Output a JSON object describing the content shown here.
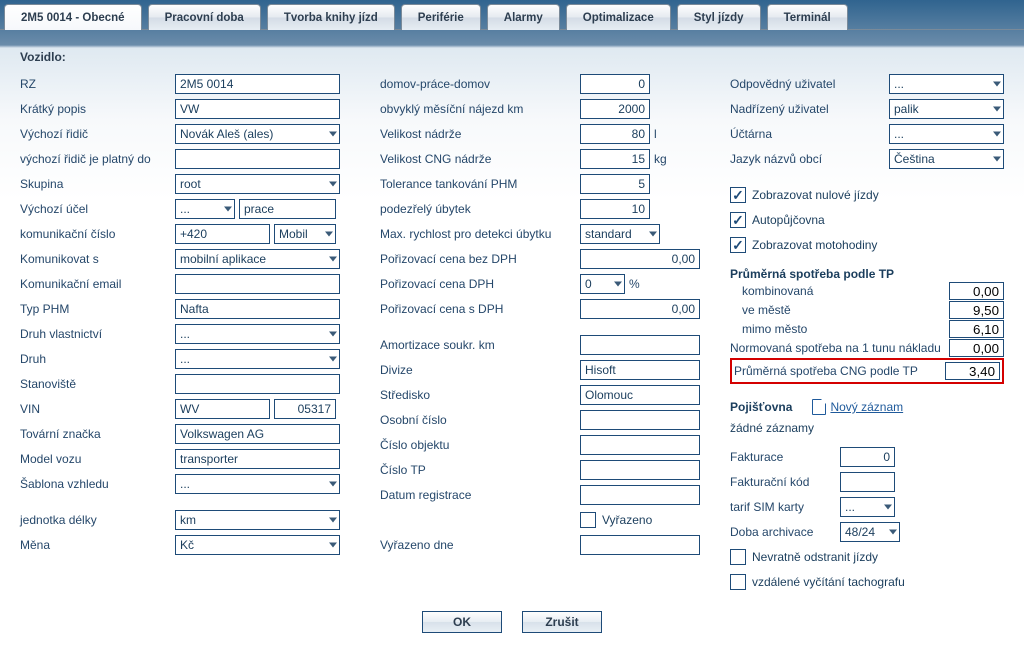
{
  "tabs": {
    "active": "2M5 0014 - Obecné",
    "items": [
      "Pracovní doba",
      "Tvorba knihy jízd",
      "Periférie",
      "Alarmy",
      "Optimalizace",
      "Styl jízdy",
      "Terminál"
    ]
  },
  "section_vehicle": "Vozidlo:",
  "col1": {
    "rz": {
      "label": "RZ",
      "value": "2M5 0014"
    },
    "kratky": {
      "label": "Krátký popis",
      "value": "VW"
    },
    "vychozi_ridic": {
      "label": "Výchozí řidič",
      "value": "Novák Aleš (ales)"
    },
    "platny_do": {
      "label": "výchozí řidič je platný do",
      "value": ""
    },
    "skupina": {
      "label": "Skupina",
      "value": "root"
    },
    "vychozi_ucel": {
      "label": "Výchozí účel",
      "sel": "...",
      "txt": "prace"
    },
    "kom_cislo": {
      "label": "komunikační číslo",
      "value": "+420",
      "badge": "Mobil"
    },
    "komunikovat_s": {
      "label": "Komunikovat s",
      "value": "mobilní aplikace"
    },
    "kom_email": {
      "label": "Komunikační email",
      "value": ""
    },
    "typ_phm": {
      "label": "Typ PHM",
      "value": "Nafta"
    },
    "druh_vlast": {
      "label": "Druh vlastnictví",
      "value": "..."
    },
    "druh": {
      "label": "Druh",
      "value": "..."
    },
    "stanoviste": {
      "label": "Stanoviště",
      "value": ""
    },
    "vin": {
      "label": "VIN",
      "left": "WV",
      "right": "05317"
    },
    "znacka": {
      "label": "Tovární značka",
      "value": "Volkswagen AG"
    },
    "model": {
      "label": "Model vozu",
      "value": "transporter"
    },
    "sablona": {
      "label": "Šablona vzhledu",
      "value": "..."
    },
    "jednotka": {
      "label": "jednotka délky",
      "value": "km"
    },
    "mena": {
      "label": "Měna",
      "value": "Kč"
    }
  },
  "col2": {
    "domov": {
      "label": "domov-práce-domov",
      "value": "0"
    },
    "najezd": {
      "label": "obvyklý měsíční nájezd km",
      "value": "2000"
    },
    "nadrz": {
      "label": "Velikost nádrže",
      "value": "80",
      "unit": "l"
    },
    "cng": {
      "label": "Velikost CNG nádrže",
      "value": "15",
      "unit": "kg"
    },
    "tolerance": {
      "label": "Tolerance tankování PHM",
      "value": "5"
    },
    "ubytek": {
      "label": "podezřelý úbytek",
      "value": "10"
    },
    "maxrychlost": {
      "label": "Max. rychlost pro detekci úbytku",
      "value": "standard"
    },
    "cenabez": {
      "label": "Pořizovací cena bez DPH",
      "value": "0,00"
    },
    "cenadph": {
      "label": "Pořizovací cena DPH",
      "sel": "0",
      "unit": "%"
    },
    "cenas": {
      "label": "Pořizovací cena s DPH",
      "value": "0,00"
    },
    "amortizace": {
      "label": "Amortizace soukr. km",
      "value": ""
    },
    "divize": {
      "label": "Divize",
      "value": "Hisoft"
    },
    "stredisko": {
      "label": "Středisko",
      "value": "Olomouc"
    },
    "oscislo": {
      "label": "Osobní číslo",
      "value": ""
    },
    "cisloobj": {
      "label": "Číslo objektu",
      "value": ""
    },
    "cislotp": {
      "label": "Číslo TP",
      "value": ""
    },
    "datum": {
      "label": "Datum registrace",
      "value": ""
    },
    "vyrazeno_chk": {
      "label": "Vyřazeno",
      "checked": false
    },
    "vyrazeno_dne": {
      "label": "Vyřazeno dne",
      "value": ""
    }
  },
  "col3": {
    "odpovedny": {
      "label": "Odpovědný uživatel",
      "value": "..."
    },
    "nadrizeny": {
      "label": "Nadřízený uživatel",
      "value": "palik"
    },
    "uctarna": {
      "label": "Účtárna",
      "value": "..."
    },
    "jazyk": {
      "label": "Jazyk názvů obcí",
      "value": "Čeština"
    },
    "chk_nulove": {
      "label": "Zobrazovat nulové jízdy",
      "checked": true
    },
    "chk_auto": {
      "label": "Autopůjčovna",
      "checked": true
    },
    "chk_moto": {
      "label": "Zobrazovat motohodiny",
      "checked": true
    },
    "consume_title": "Průměrná spotřeba podle TP",
    "consume": {
      "komb": {
        "label": "kombinovaná",
        "value": "0,00"
      },
      "mesto": {
        "label": "ve městě",
        "value": "9,50"
      },
      "mimo": {
        "label": "mimo město",
        "value": "6,10"
      },
      "norm": {
        "label": "Normovaná spotřeba na 1 tunu nákladu",
        "value": "0,00"
      },
      "cng": {
        "label": "Průměrná spotřeba CNG podle TP",
        "value": "3,40"
      }
    },
    "pojistovna_title": "Pojišťovna",
    "novy_zaznam": "Nový záznam",
    "zadne": "žádné záznamy",
    "fakturace": {
      "label": "Fakturace",
      "value": "0"
    },
    "fakt_kod": {
      "label": "Fakturační kód",
      "value": ""
    },
    "tarif": {
      "label": "tarif SIM karty",
      "value": "..."
    },
    "archivace": {
      "label": "Doba archivace",
      "value": "48/24"
    },
    "chk_nevratne": {
      "label": "Nevratně odstranit jízdy",
      "checked": false
    },
    "chk_vzdalene": {
      "label": "vzdálené vyčítání tachografu",
      "checked": false
    }
  },
  "buttons": {
    "ok": "OK",
    "cancel": "Zrušit"
  }
}
